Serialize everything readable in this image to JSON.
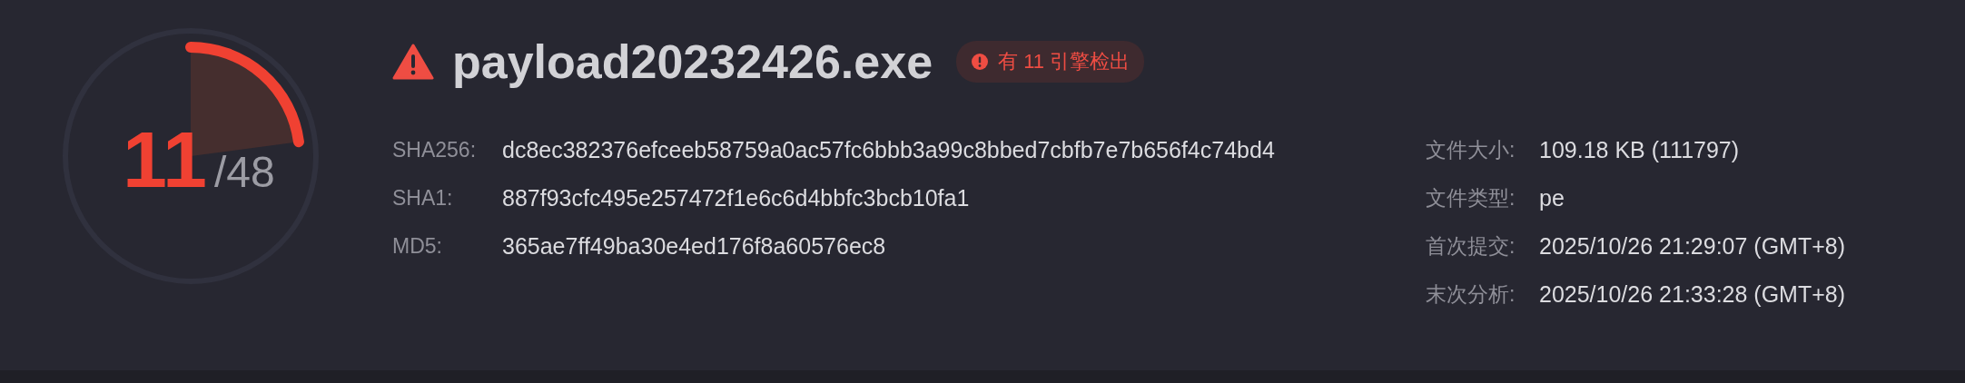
{
  "gauge": {
    "score": "11",
    "total": "/48"
  },
  "file": {
    "name": "payload20232426.exe",
    "badge": {
      "kind": "danger",
      "text": "有 11 引擎检出"
    }
  },
  "hashes": [
    {
      "label": "SHA256:",
      "value": "dc8ec382376efceeb58759a0ac57fc6bbb3a99c8bbed7cbfb7e7b656f4c74bd4"
    },
    {
      "label": "SHA1:",
      "value": "887f93cfc495e257472f1e6c6d4bbfc3bcb10fa1"
    },
    {
      "label": "MD5:",
      "value": "365ae7ff49ba30e4ed176f8a60576ec8"
    }
  ],
  "details": [
    {
      "label": "文件大小:",
      "value": "109.18 KB (111797)"
    },
    {
      "label": "文件类型:",
      "value": "pe"
    },
    {
      "label": "首次提交:",
      "value": "2025/10/26 21:29:07 (GMT+8)"
    },
    {
      "label": "末次分析:",
      "value": "2025/10/26 21:33:28 (GMT+8)"
    }
  ]
}
